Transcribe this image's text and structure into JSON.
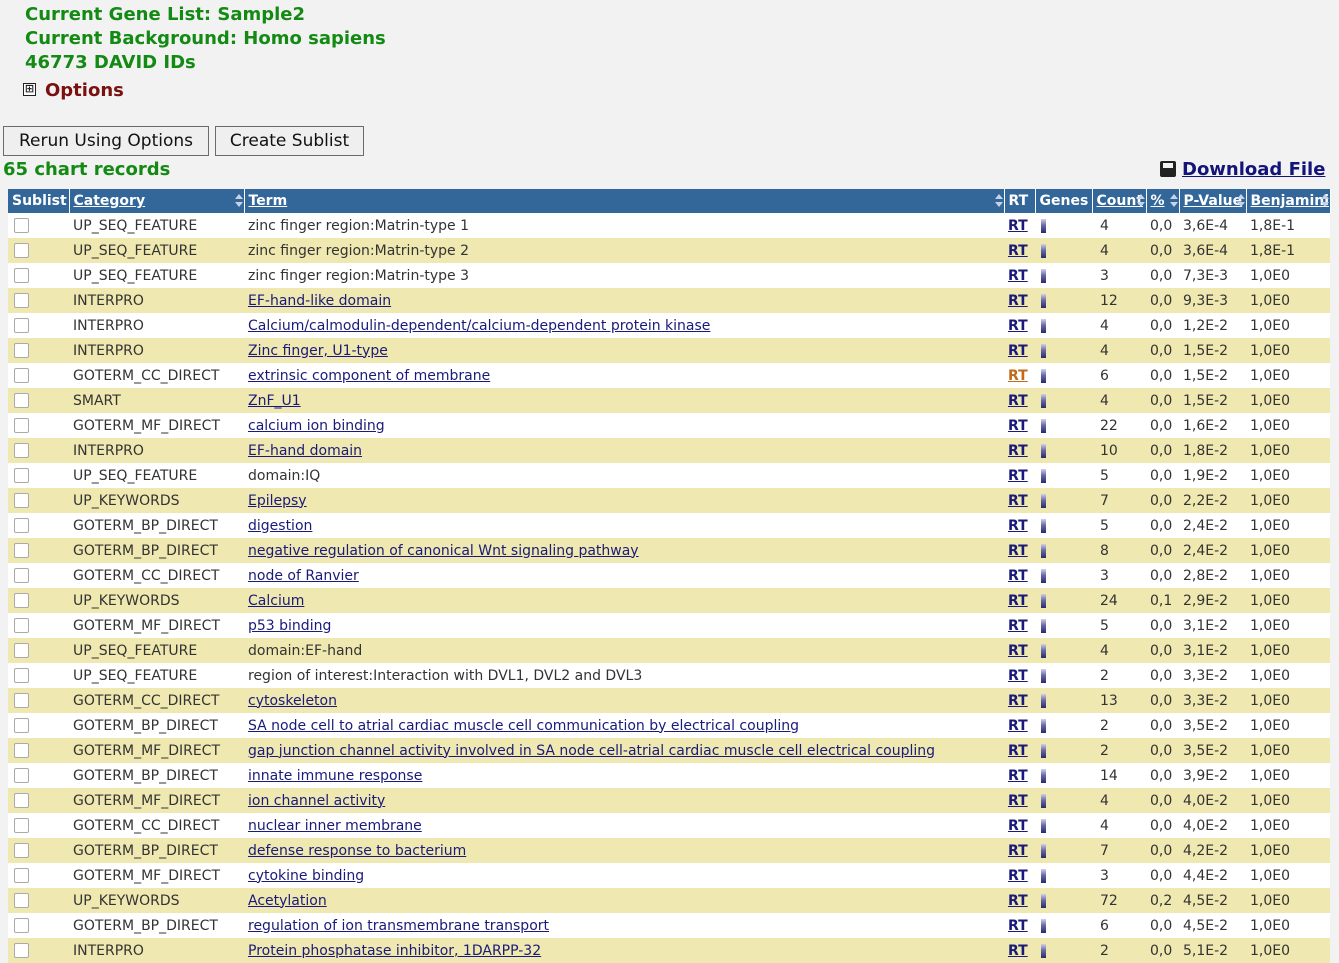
{
  "header": {
    "gene_list": "Current Gene List: Sample2",
    "background": "Current Background: Homo sapiens",
    "david_ids": "46773 DAVID IDs",
    "options_label": "Options",
    "options_toggle": "⊞"
  },
  "buttons": {
    "rerun": "Rerun Using Options",
    "create_sublist": "Create Sublist"
  },
  "records_label": "65 chart records",
  "download_label": "Download File",
  "table": {
    "columns": [
      "Sublist",
      "Category",
      "Term",
      "RT",
      "Genes",
      "Count",
      "%",
      "P-Value",
      "Benjamini"
    ],
    "rows": [
      {
        "category": "UP_SEQ_FEATURE",
        "term": "zinc finger region:Matrin-type 1",
        "linked": false,
        "rt": "RT",
        "count": "4",
        "pct": "0,0",
        "pvalue": "3,6E-4",
        "benjamini": "1,8E-1"
      },
      {
        "category": "UP_SEQ_FEATURE",
        "term": "zinc finger region:Matrin-type 2",
        "linked": false,
        "rt": "RT",
        "count": "4",
        "pct": "0,0",
        "pvalue": "3,6E-4",
        "benjamini": "1,8E-1"
      },
      {
        "category": "UP_SEQ_FEATURE",
        "term": "zinc finger region:Matrin-type 3",
        "linked": false,
        "rt": "RT",
        "count": "3",
        "pct": "0,0",
        "pvalue": "7,3E-3",
        "benjamini": "1,0E0"
      },
      {
        "category": "INTERPRO",
        "term": "EF-hand-like domain",
        "linked": true,
        "rt": "RT",
        "count": "12",
        "pct": "0,0",
        "pvalue": "9,3E-3",
        "benjamini": "1,0E0"
      },
      {
        "category": "INTERPRO",
        "term": "Calcium/calmodulin-dependent/calcium-dependent protein kinase",
        "linked": true,
        "rt": "RT",
        "count": "4",
        "pct": "0,0",
        "pvalue": "1,2E-2",
        "benjamini": "1,0E0"
      },
      {
        "category": "INTERPRO",
        "term": "Zinc finger, U1-type",
        "linked": true,
        "rt": "RT",
        "count": "4",
        "pct": "0,0",
        "pvalue": "1,5E-2",
        "benjamini": "1,0E0"
      },
      {
        "category": "GOTERM_CC_DIRECT",
        "term": "extrinsic component of membrane",
        "linked": true,
        "rt": "RT",
        "rt_visited": true,
        "count": "6",
        "pct": "0,0",
        "pvalue": "1,5E-2",
        "benjamini": "1,0E0"
      },
      {
        "category": "SMART",
        "term": "ZnF_U1",
        "linked": true,
        "rt": "RT",
        "count": "4",
        "pct": "0,0",
        "pvalue": "1,5E-2",
        "benjamini": "1,0E0"
      },
      {
        "category": "GOTERM_MF_DIRECT",
        "term": "calcium ion binding",
        "linked": true,
        "rt": "RT",
        "count": "22",
        "pct": "0,0",
        "pvalue": "1,6E-2",
        "benjamini": "1,0E0"
      },
      {
        "category": "INTERPRO",
        "term": "EF-hand domain",
        "linked": true,
        "rt": "RT",
        "count": "10",
        "pct": "0,0",
        "pvalue": "1,8E-2",
        "benjamini": "1,0E0"
      },
      {
        "category": "UP_SEQ_FEATURE",
        "term": "domain:IQ",
        "linked": false,
        "rt": "RT",
        "count": "5",
        "pct": "0,0",
        "pvalue": "1,9E-2",
        "benjamini": "1,0E0"
      },
      {
        "category": "UP_KEYWORDS",
        "term": "Epilepsy",
        "linked": true,
        "rt": "RT",
        "count": "7",
        "pct": "0,0",
        "pvalue": "2,2E-2",
        "benjamini": "1,0E0"
      },
      {
        "category": "GOTERM_BP_DIRECT",
        "term": "digestion",
        "linked": true,
        "rt": "RT",
        "count": "5",
        "pct": "0,0",
        "pvalue": "2,4E-2",
        "benjamini": "1,0E0"
      },
      {
        "category": "GOTERM_BP_DIRECT",
        "term": "negative regulation of canonical Wnt signaling pathway",
        "linked": true,
        "rt": "RT",
        "count": "8",
        "pct": "0,0",
        "pvalue": "2,4E-2",
        "benjamini": "1,0E0"
      },
      {
        "category": "GOTERM_CC_DIRECT",
        "term": "node of Ranvier",
        "linked": true,
        "rt": "RT",
        "count": "3",
        "pct": "0,0",
        "pvalue": "2,8E-2",
        "benjamini": "1,0E0"
      },
      {
        "category": "UP_KEYWORDS",
        "term": "Calcium",
        "linked": true,
        "rt": "RT",
        "count": "24",
        "pct": "0,1",
        "pvalue": "2,9E-2",
        "benjamini": "1,0E0"
      },
      {
        "category": "GOTERM_MF_DIRECT",
        "term": "p53 binding",
        "linked": true,
        "rt": "RT",
        "count": "5",
        "pct": "0,0",
        "pvalue": "3,1E-2",
        "benjamini": "1,0E0"
      },
      {
        "category": "UP_SEQ_FEATURE",
        "term": "domain:EF-hand",
        "linked": false,
        "rt": "RT",
        "count": "4",
        "pct": "0,0",
        "pvalue": "3,1E-2",
        "benjamini": "1,0E0"
      },
      {
        "category": "UP_SEQ_FEATURE",
        "term": "region of interest:Interaction with DVL1, DVL2 and DVL3",
        "linked": false,
        "rt": "RT",
        "count": "2",
        "pct": "0,0",
        "pvalue": "3,3E-2",
        "benjamini": "1,0E0"
      },
      {
        "category": "GOTERM_CC_DIRECT",
        "term": "cytoskeleton",
        "linked": true,
        "rt": "RT",
        "count": "13",
        "pct": "0,0",
        "pvalue": "3,3E-2",
        "benjamini": "1,0E0"
      },
      {
        "category": "GOTERM_BP_DIRECT",
        "term": "SA node cell to atrial cardiac muscle cell communication by electrical coupling",
        "linked": true,
        "rt": "RT",
        "count": "2",
        "pct": "0,0",
        "pvalue": "3,5E-2",
        "benjamini": "1,0E0"
      },
      {
        "category": "GOTERM_MF_DIRECT",
        "term": "gap junction channel activity involved in SA node cell-atrial cardiac muscle cell electrical coupling",
        "linked": true,
        "rt": "RT",
        "count": "2",
        "pct": "0,0",
        "pvalue": "3,5E-2",
        "benjamini": "1,0E0"
      },
      {
        "category": "GOTERM_BP_DIRECT",
        "term": "innate immune response",
        "linked": true,
        "rt": "RT",
        "count": "14",
        "pct": "0,0",
        "pvalue": "3,9E-2",
        "benjamini": "1,0E0"
      },
      {
        "category": "GOTERM_MF_DIRECT",
        "term": "ion channel activity",
        "linked": true,
        "rt": "RT",
        "count": "4",
        "pct": "0,0",
        "pvalue": "4,0E-2",
        "benjamini": "1,0E0"
      },
      {
        "category": "GOTERM_CC_DIRECT",
        "term": "nuclear inner membrane",
        "linked": true,
        "rt": "RT",
        "count": "4",
        "pct": "0,0",
        "pvalue": "4,0E-2",
        "benjamini": "1,0E0"
      },
      {
        "category": "GOTERM_BP_DIRECT",
        "term": "defense response to bacterium",
        "linked": true,
        "rt": "RT",
        "count": "7",
        "pct": "0,0",
        "pvalue": "4,2E-2",
        "benjamini": "1,0E0"
      },
      {
        "category": "GOTERM_MF_DIRECT",
        "term": "cytokine binding",
        "linked": true,
        "rt": "RT",
        "count": "3",
        "pct": "0,0",
        "pvalue": "4,4E-2",
        "benjamini": "1,0E0"
      },
      {
        "category": "UP_KEYWORDS",
        "term": "Acetylation",
        "linked": true,
        "rt": "RT",
        "count": "72",
        "pct": "0,2",
        "pvalue": "4,5E-2",
        "benjamini": "1,0E0"
      },
      {
        "category": "GOTERM_BP_DIRECT",
        "term": "regulation of ion transmembrane transport",
        "linked": true,
        "rt": "RT",
        "count": "6",
        "pct": "0,0",
        "pvalue": "4,5E-2",
        "benjamini": "1,0E0"
      },
      {
        "category": "INTERPRO",
        "term": "Protein phosphatase inhibitor, 1DARPP-32",
        "linked": true,
        "rt": "RT",
        "count": "2",
        "pct": "0,0",
        "pvalue": "5,1E-2",
        "benjamini": "1,0E0"
      }
    ]
  }
}
